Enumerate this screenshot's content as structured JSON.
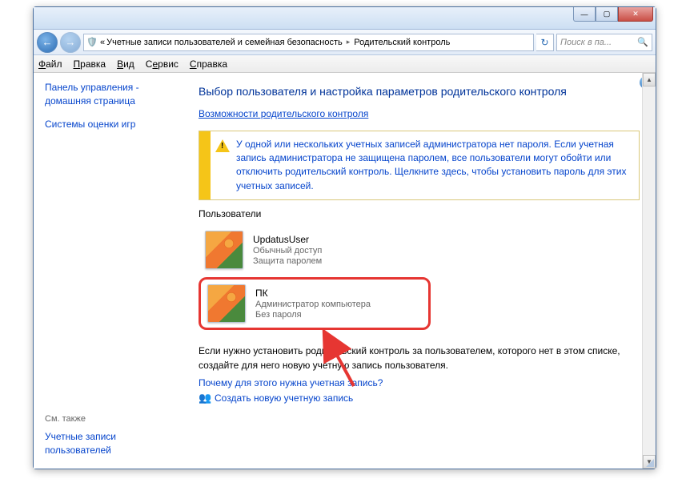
{
  "window": {
    "min": "—",
    "max": "▢",
    "close": "✕"
  },
  "nav": {
    "back": "←",
    "fwd": "→",
    "chevrons": "«",
    "bc1": "Учетные записи пользователей и семейная безопасность",
    "bc2": "Родительский контроль",
    "sep": "▸",
    "refresh": "↻",
    "search_placeholder": "Поиск в па...",
    "search_icon": "🔍"
  },
  "menu": {
    "file": "Файл",
    "edit": "Правка",
    "view": "Вид",
    "tools": "Сервис",
    "help": "Справка"
  },
  "sidebar": {
    "home": "Панель управления - домашняя страница",
    "ratings": "Системы оценки игр",
    "also": "См. также",
    "accounts": "Учетные записи пользователей"
  },
  "main": {
    "title": "Выбор пользователя и настройка параметров родительского контроля",
    "capabilities": "Возможности родительского контроля",
    "warning": "У одной или нескольких учетных записей администратора нет пароля. Если учетная запись администратора не защищена паролем, все пользователи могут обойти или отключить родительский контроль. Щелкните здесь, чтобы установить пароль для этих учетных записей.",
    "users_label": "Пользователи",
    "users": [
      {
        "name": "UpdatusUser",
        "type": "Обычный доступ",
        "pwd": "Защита паролем"
      },
      {
        "name": "ПК",
        "type": "Администратор компьютера",
        "pwd": "Без пароля"
      }
    ],
    "hint": "Если нужно установить родительский контроль за пользователем, которого нет в этом списке, создайте для него новую учетную запись пользователя.",
    "why": "Почему для этого нужна учетная запись?",
    "create": "Создать новую учетную запись",
    "help": "?"
  }
}
